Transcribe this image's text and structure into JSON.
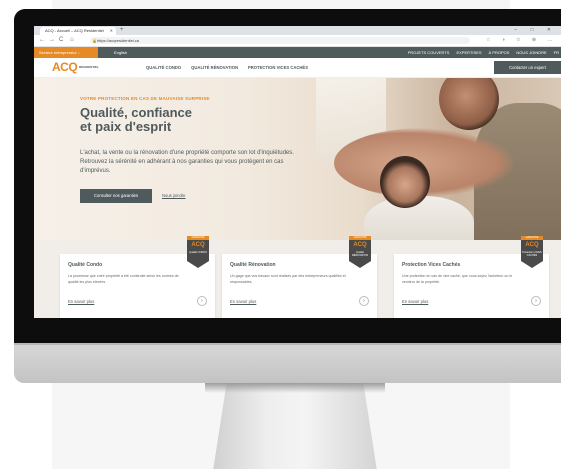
{
  "browser": {
    "tab_title": "ACQ - Accueil – ACQ Résidentiel",
    "new_tab": "+",
    "window_controls": "– □ ✕",
    "url": "https://acqresidentiel.ca",
    "nav": [
      "←",
      "→",
      "C",
      "⌂"
    ],
    "toolbar_icons": "☆ ◑ ✩ ⊕ …"
  },
  "topbar": {
    "sector": "Secteur entrepreneur ↓",
    "language": "English",
    "links": [
      "PROJETS COUVERTS",
      "EXPERTISES",
      "À PROPOS",
      "NOUS JOINDRE",
      "FR"
    ]
  },
  "mainnav": {
    "logo": "ACQ",
    "logo_sub": "RÉSIDENTIEL",
    "links": [
      "QUALITÉ CONDO",
      "QUALITÉ RÉNOVATION",
      "PROTECTION VICES CACHÉS"
    ],
    "contact": "Contacter un expert"
  },
  "hero": {
    "kicker": "VOTRE PROTECTION EN CAS DE MAUVAISE SURPRISE",
    "title_line1": "Qualité, confiance",
    "title_line2": "et paix d'esprit",
    "lead": "L'achat, la vente ou la rénovation d'une propriété comporte son lot d'inquiétudes. Retrouvez la sérénité en adhérant à nos garanties qui vous protègent en cas d'imprévus.",
    "cta": "Consulter nos garanties",
    "link": "Nous joindre"
  },
  "cards": [
    {
      "title": "Qualité Condo",
      "text": "La promesse que votre propriété a été construite selon les normes de qualité les plus élevées.",
      "link": "En savoir plus",
      "badge_top": "GARANTIE",
      "badge_logo": "ACQ",
      "badge_sub": "Qualité CONDO"
    },
    {
      "title": "Qualité Rénovation",
      "text": "Un gage que vos travaux sont réalisés par des entrepreneurs qualifiés et responsables.",
      "link": "En savoir plus",
      "badge_top": "GARANTIE",
      "badge_logo": "ACQ",
      "badge_sub": "Qualité RÉNOVATION"
    },
    {
      "title": "Protection Vices Cachés",
      "text": "Une protection en cas de vice caché, que vous soyez l'acheteur ou le vendeur de la propriété.",
      "link": "En savoir plus",
      "badge_top": "GARANTIE",
      "badge_logo": "ACQ",
      "badge_sub": "Protection VICES CACHÉS"
    }
  ],
  "colors": {
    "accent": "#e58a25",
    "brand": "#4f5a5c"
  },
  "icons": {
    "arrow": "arrow-right-icon",
    "lock": "lock-icon"
  }
}
